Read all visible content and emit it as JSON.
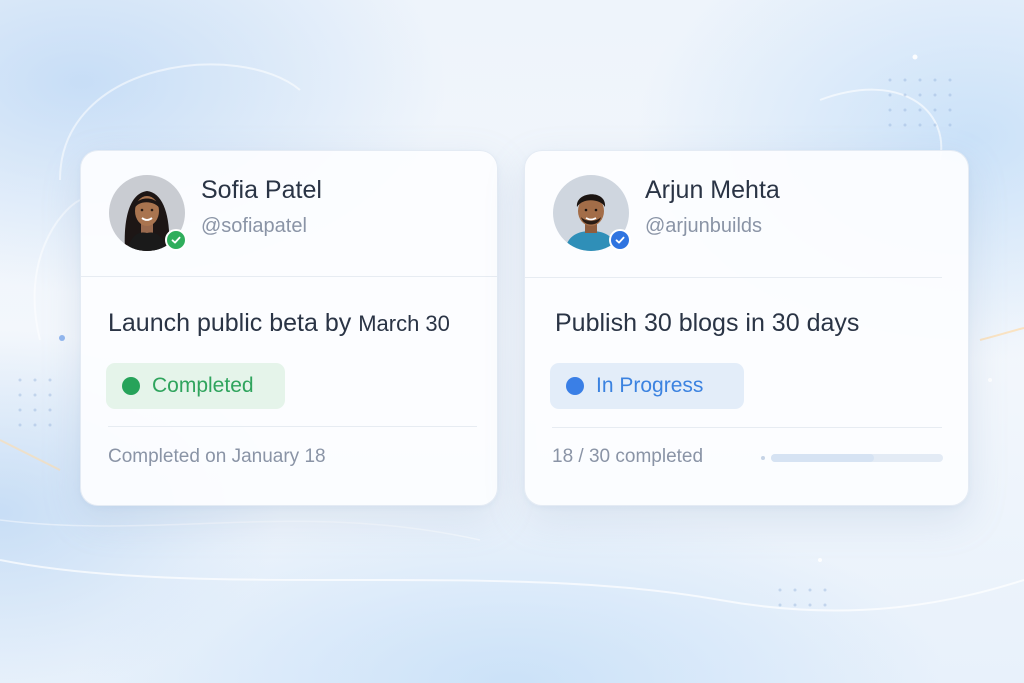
{
  "cards": [
    {
      "user": {
        "name": "Sofia Patel",
        "handle": "@sofiapatel",
        "verified_badge_color": "#2fae5c"
      },
      "goal": {
        "text_main": "Launch public beta by ",
        "text_date": "March 30"
      },
      "status": {
        "label": "Completed",
        "color": "#2fa45d"
      },
      "footer": "Completed on January 18"
    },
    {
      "user": {
        "name": "Arjun Mehta",
        "handle": "@arjunbuilds",
        "verified_badge_color": "#2f74e0"
      },
      "goal": {
        "text": "Publish 30 blogs in 30 days"
      },
      "status": {
        "label": "In Progress",
        "color": "#3b82e0"
      },
      "progress": {
        "text": "18 / 30 completed",
        "done": 18,
        "total": 30
      }
    }
  ]
}
